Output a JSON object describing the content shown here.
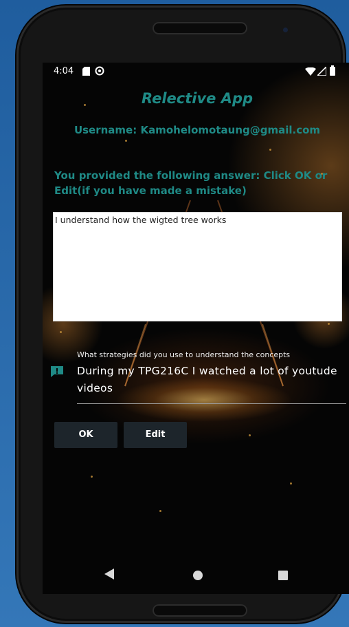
{
  "status_bar": {
    "time": "4:04"
  },
  "app": {
    "title": "Relective App",
    "username_line": "Username: Kamohelomotaung@gmail.com",
    "prompt": "You provided the following answer: Click OK or Edit(if you have made a mistake)"
  },
  "answer": {
    "text": "I understand how the wigted tree works"
  },
  "strategy_field": {
    "label": "What strategies did you use to understand the concepts",
    "value": "During my TPG216C I watched a lot of youtude videos",
    "icon": "feedback-icon"
  },
  "buttons": {
    "ok_label": "OK",
    "edit_label": "Edit"
  },
  "nav": {
    "back_icon": "back-icon",
    "home_icon": "home-icon",
    "recents_icon": "recents-icon"
  },
  "colors": {
    "accent": "#1f8a86",
    "button_bg": "#1d252b",
    "screen_bg": "#050505"
  }
}
